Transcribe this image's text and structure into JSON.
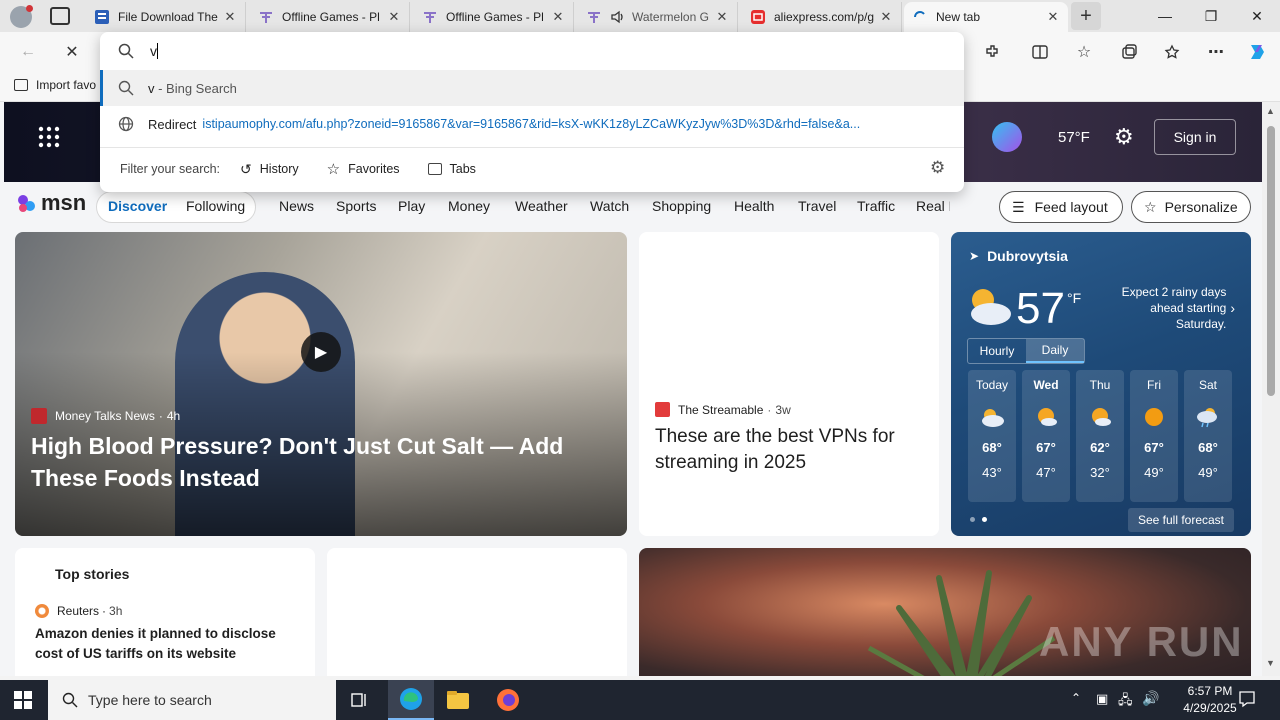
{
  "tabs": [
    {
      "label": "File Download The",
      "icon": "word-doc-icon"
    },
    {
      "label": "Offline Games - Pl",
      "icon": "game-tab-icon"
    },
    {
      "label": "Offline Games - Pl",
      "icon": "game-tab-icon"
    },
    {
      "label": "Watermelon G",
      "icon": "game-tab-icon"
    },
    {
      "label": "aliexpress.com/p/g",
      "icon": "aliexpress-icon"
    },
    {
      "label": "New tab",
      "icon": "loading-spinner-icon"
    }
  ],
  "omnibox": {
    "query": "v",
    "suggestions": [
      {
        "title": "v",
        "detail": " - Bing Search"
      },
      {
        "title": "Redirect",
        "detail": "istipaumophy.com/afu.php?zoneid=9165867&var=9165867&rid=ksX-wKK1z8yLZCaWKyzJyw%3D%3D&rhd=false&a..."
      }
    ],
    "filter_label": "Filter your search:",
    "filters": [
      "History",
      "Favorites",
      "Tabs"
    ]
  },
  "favorites": {
    "import_label": "Import favo"
  },
  "msn": {
    "logo_text": "msn",
    "header_temp": "57°F",
    "sign_in": "Sign in",
    "nav": [
      "Discover",
      "Following",
      "News",
      "Sports",
      "Play",
      "Money",
      "Weather",
      "Watch",
      "Shopping",
      "Health",
      "Travel",
      "Traffic",
      "Real E"
    ],
    "feed_layout": "Feed layout",
    "personalize": "Personalize",
    "hero": {
      "source": "Money Talks News",
      "age": "4h",
      "title": "High Blood Pressure? Don't Just Cut Salt — Add These Foods Instead"
    },
    "vpn_card": {
      "source": "The Streamable",
      "age": "3w",
      "title": "These are the best VPNs for streaming in 2025"
    },
    "top_stories": {
      "heading": "Top stories",
      "source": "Reuters",
      "age": "3h",
      "title": "Amazon denies it planned to disclose cost of US tariffs on its website"
    },
    "weather": {
      "location": "Dubrovytsia",
      "temp": "57",
      "unit": "°F",
      "alert": "Expect 2 rainy days ahead starting Saturday.",
      "tabs": [
        "Hourly",
        "Daily"
      ],
      "days": [
        {
          "name": "Today",
          "hi": "68°",
          "lo": "43°"
        },
        {
          "name": "Wed",
          "hi": "67°",
          "lo": "47°"
        },
        {
          "name": "Thu",
          "hi": "62°",
          "lo": "32°"
        },
        {
          "name": "Fri",
          "hi": "67°",
          "lo": "49°"
        },
        {
          "name": "Sat",
          "hi": "68°",
          "lo": "49°"
        }
      ],
      "full_forecast": "See full forecast"
    },
    "watermark": "ANY RUN"
  },
  "taskbar": {
    "search_placeholder": "Type here to search",
    "time": "6:57 PM",
    "date": "4/29/2025"
  },
  "colors": {
    "accent": "#0f6cbd",
    "weather_bg": "#1e4a78",
    "taskbar": "#1f2530"
  }
}
